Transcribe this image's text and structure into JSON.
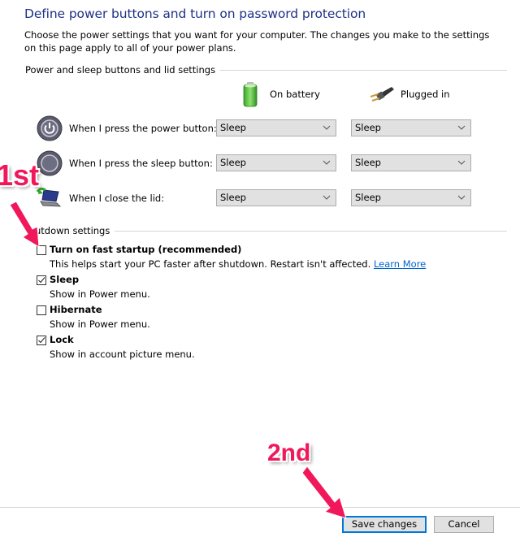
{
  "page": {
    "title": "Define power buttons and turn on password protection",
    "intro": "Choose the power settings that you want for your computer. The changes you make to the settings on this page apply to all of your power plans."
  },
  "power_section": {
    "label": "Power and sleep buttons and lid settings",
    "columns": [
      {
        "label": "On battery",
        "icon": "battery-icon"
      },
      {
        "label": "Plugged in",
        "icon": "power-plug-icon"
      }
    ],
    "rows": [
      {
        "label": "When I press the power button:",
        "icon": "power-button-icon",
        "on_battery": "Sleep",
        "plugged_in": "Sleep"
      },
      {
        "label": "When I press the sleep button:",
        "icon": "sleep-button-icon",
        "on_battery": "Sleep",
        "plugged_in": "Sleep"
      },
      {
        "label": "When I close the lid:",
        "icon": "laptop-lid-icon",
        "on_battery": "Sleep",
        "plugged_in": "Sleep"
      }
    ]
  },
  "shutdown_section": {
    "label": "Shutdown settings",
    "visible_label": "utdown settings",
    "options": [
      {
        "label": "Turn on fast startup (recommended)",
        "description": "This helps start your PC faster after shutdown. Restart isn't affected.",
        "link": "Learn More",
        "checked": false
      },
      {
        "label": "Sleep",
        "description": "Show in Power menu.",
        "checked": true
      },
      {
        "label": "Hibernate",
        "description": "Show in Power menu.",
        "checked": false
      },
      {
        "label": "Lock",
        "description": "Show in account picture menu.",
        "checked": true
      }
    ]
  },
  "footer": {
    "save_label": "Save changes",
    "cancel_label": "Cancel"
  },
  "annotations": {
    "first": "1st",
    "second": "2nd",
    "color": "#f0185a"
  }
}
